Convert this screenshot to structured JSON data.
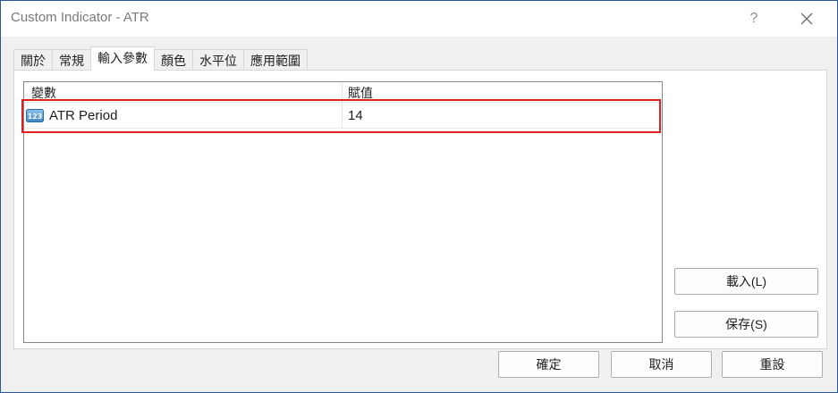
{
  "window": {
    "title": "Custom Indicator - ATR",
    "help_label": "?"
  },
  "tabs": [
    {
      "label": "關於"
    },
    {
      "label": "常規"
    },
    {
      "label": "輸入參數",
      "active": true
    },
    {
      "label": "顏色"
    },
    {
      "label": "水平位"
    },
    {
      "label": "應用範圍"
    }
  ],
  "grid": {
    "columns": [
      "變數",
      "賦值"
    ],
    "rows": [
      {
        "icon": "number-123-icon",
        "name": "ATR Period",
        "value": "14"
      }
    ]
  },
  "side_buttons": {
    "load_label": "載入(L)",
    "save_label": "保存(S)"
  },
  "footer_buttons": {
    "ok_label": "確定",
    "cancel_label": "取消",
    "reset_label": "重設"
  },
  "colors": {
    "highlight": "#e02020",
    "window_border": "#2b5797"
  }
}
